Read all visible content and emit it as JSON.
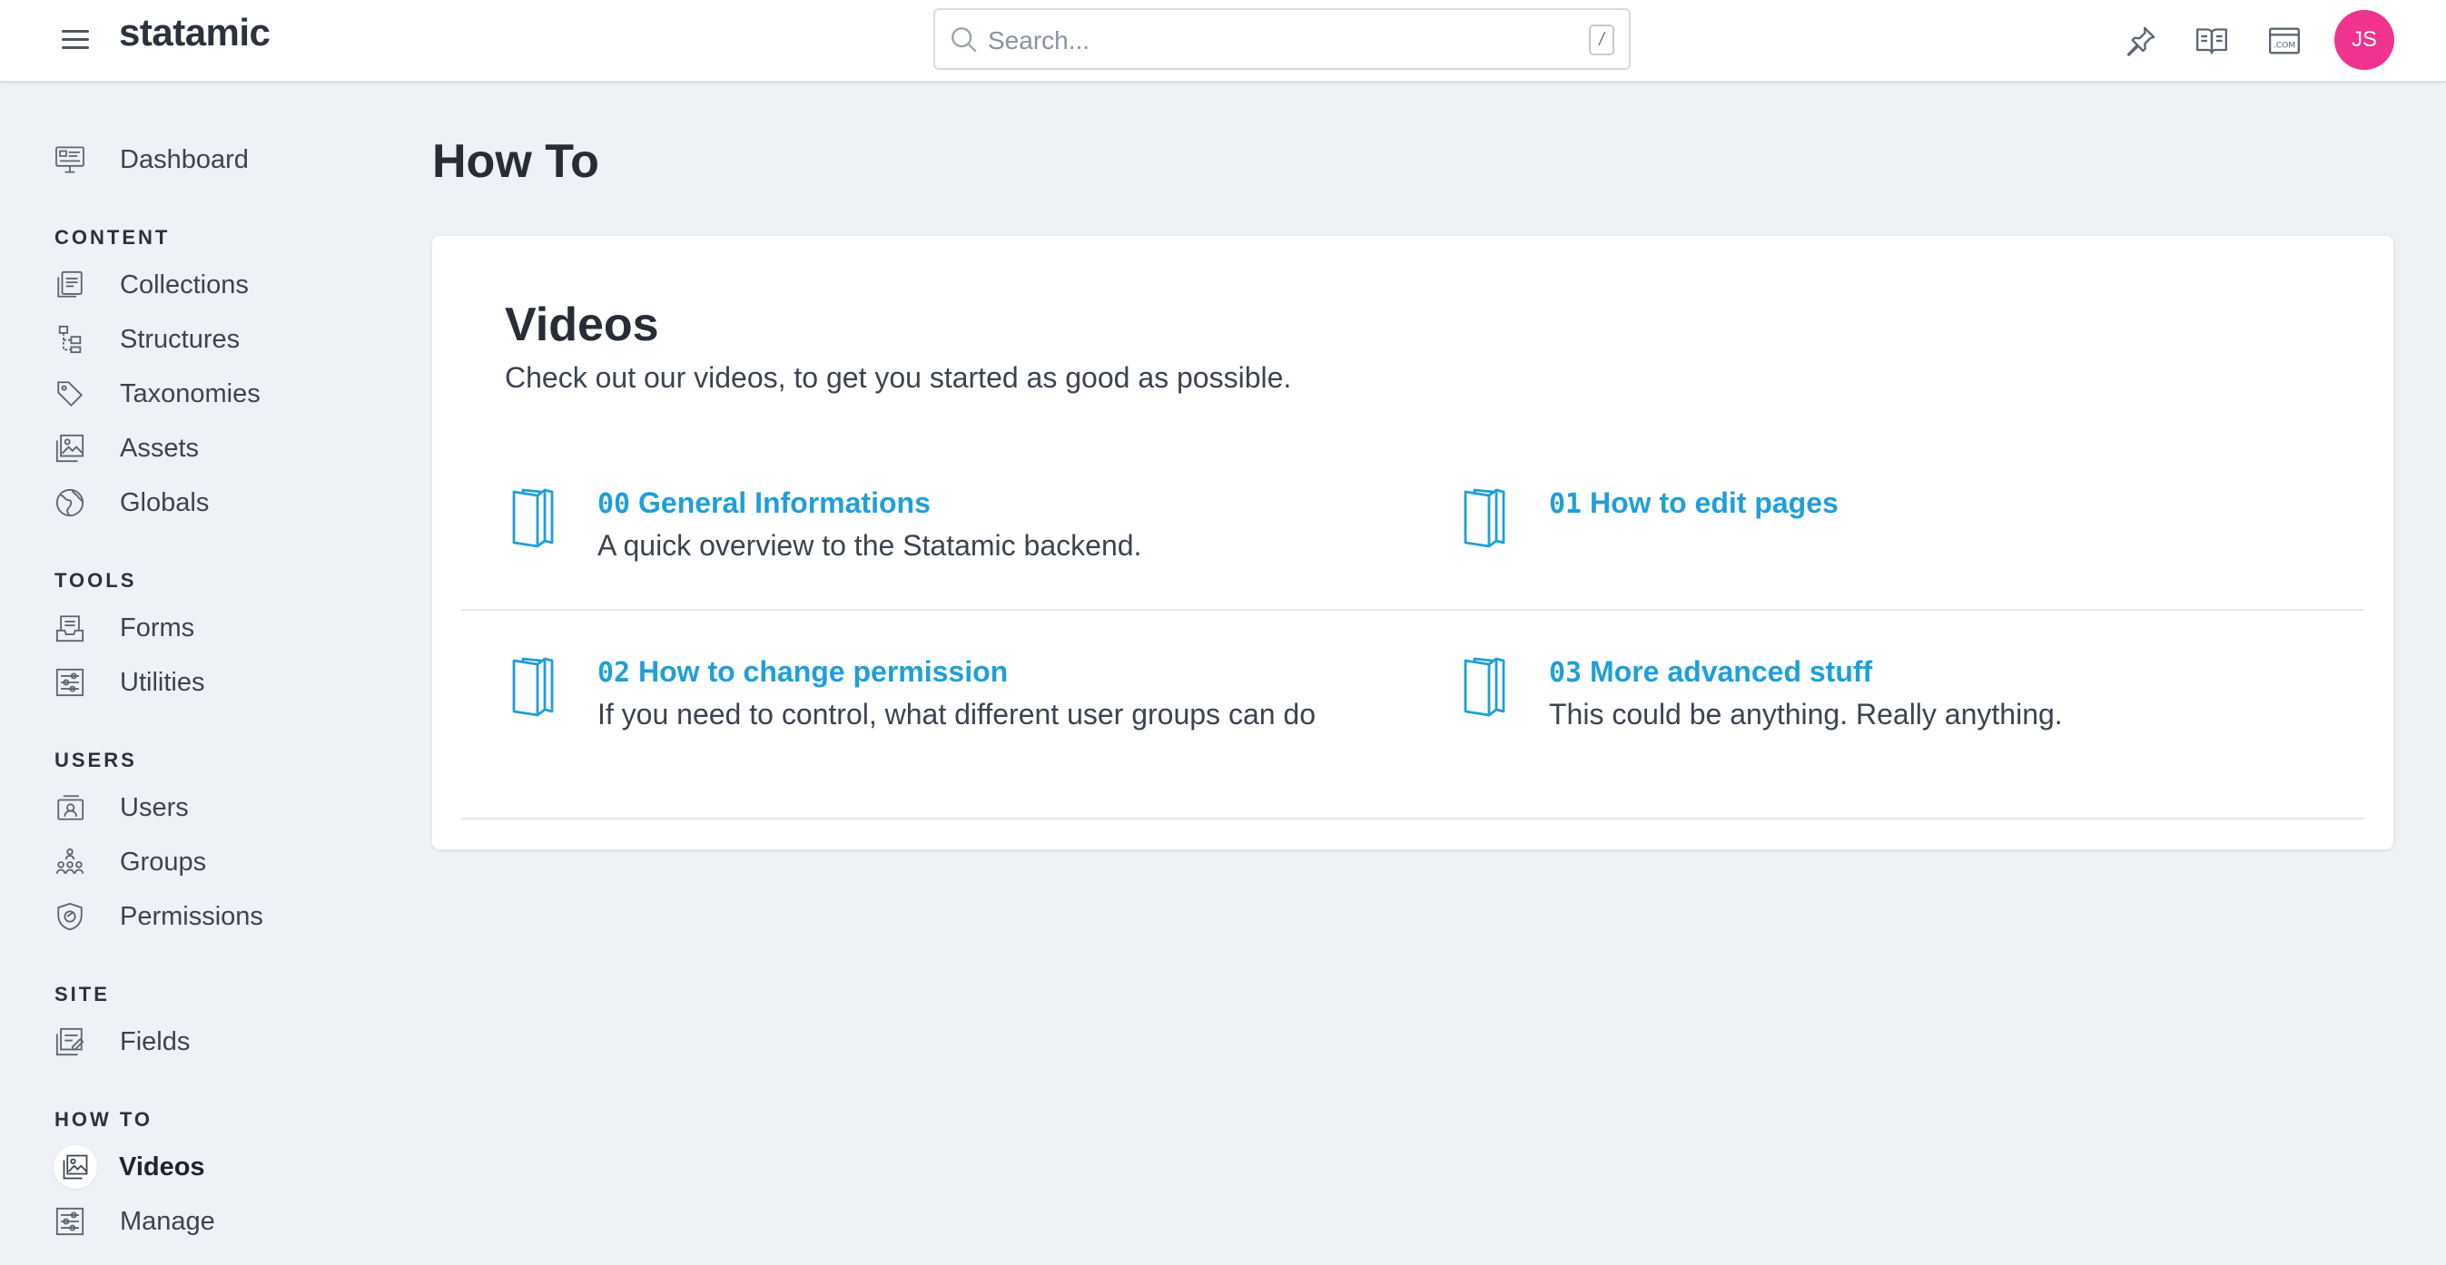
{
  "header": {
    "brand": "statamic",
    "search_placeholder": "Search...",
    "search_shortcut": "/",
    "icons": [
      "hamburger-menu-icon",
      "pin-icon",
      "book-open-icon",
      "domain-dotcom-icon"
    ],
    "avatar_initials": "JS",
    "avatar_color": "#f0338e"
  },
  "sidebar": {
    "dashboard": "Dashboard",
    "sections": [
      {
        "heading": "CONTENT",
        "items": [
          "Collections",
          "Structures",
          "Taxonomies",
          "Assets",
          "Globals"
        ]
      },
      {
        "heading": "TOOLS",
        "items": [
          "Forms",
          "Utilities"
        ]
      },
      {
        "heading": "USERS",
        "items": [
          "Users",
          "Groups",
          "Permissions"
        ]
      },
      {
        "heading": "SITE",
        "items": [
          "Fields"
        ]
      },
      {
        "heading": "HOW TO",
        "items": [
          "Videos",
          "Manage"
        ]
      }
    ],
    "active_item": "Videos"
  },
  "main": {
    "page_title": "How To",
    "card": {
      "title": "Videos",
      "subtitle": "Check out our videos, to get you started as good as possible.",
      "videos": [
        {
          "num": "00",
          "title": "General Informations",
          "description": "A quick overview to the Statamic backend."
        },
        {
          "num": "01",
          "title": "How to edit pages",
          "description": ""
        },
        {
          "num": "02",
          "title": "How to change permission",
          "description": "If you need to control, what different user groups can do"
        },
        {
          "num": "03",
          "title": "More advanced stuff",
          "description": "This could be anything. Really anything."
        }
      ]
    }
  },
  "colors": {
    "link": "#1f9fd8",
    "background": "#eef1f5",
    "card": "#ffffff"
  }
}
